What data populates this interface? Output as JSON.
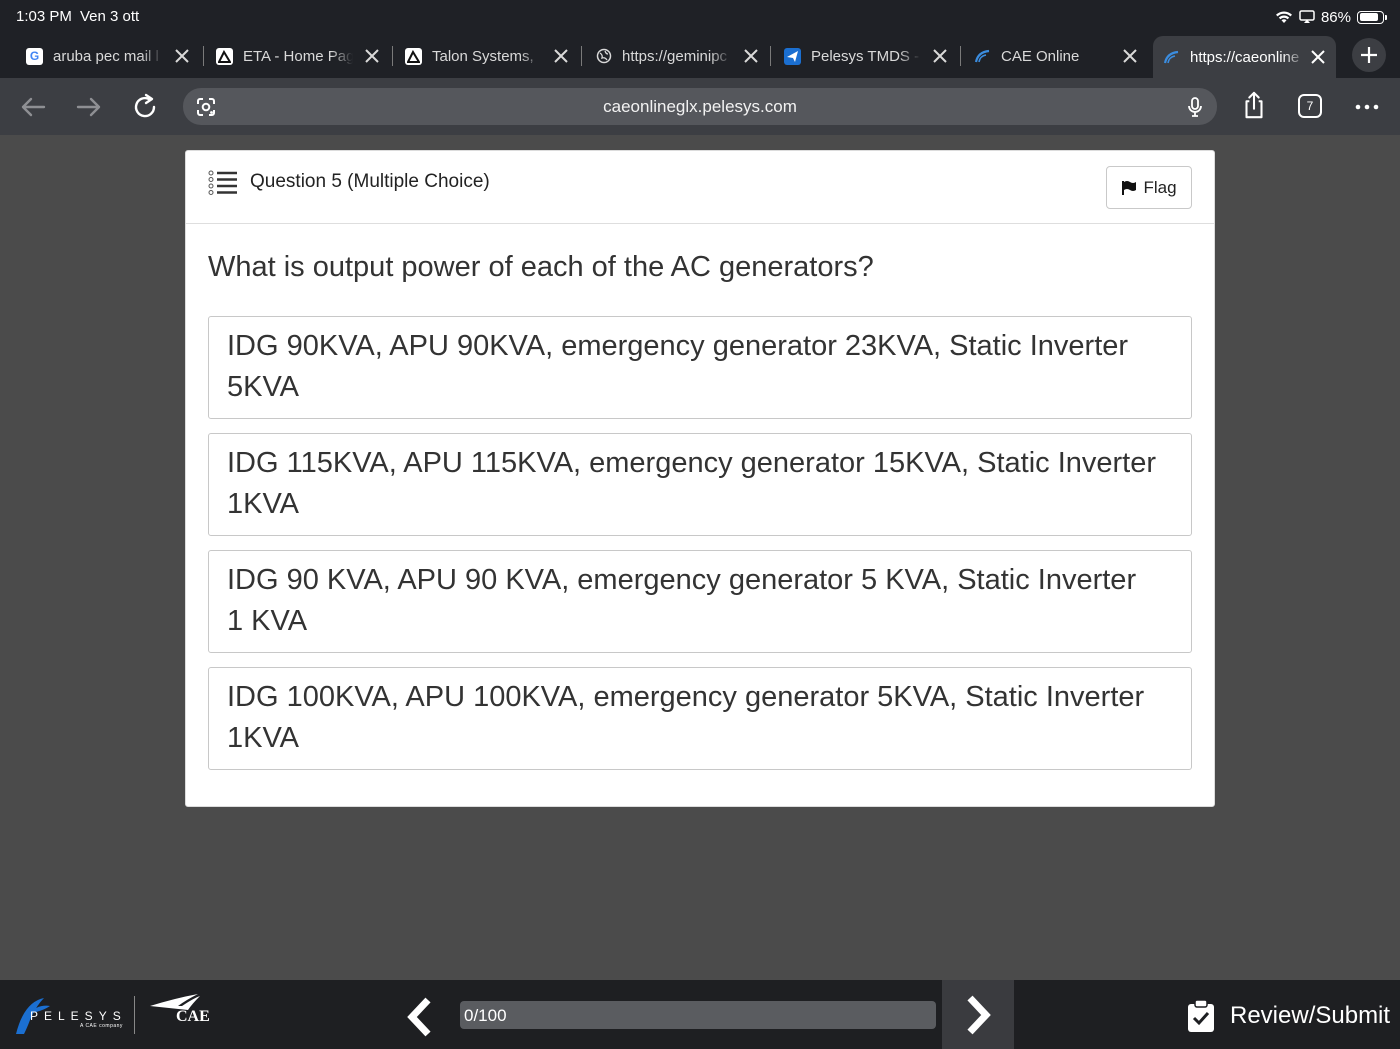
{
  "status": {
    "time": "1:03 PM",
    "date": "Ven 3 ott",
    "battery": "86%",
    "battery_level": 0.86
  },
  "tabs": [
    {
      "label": "aruba pec mail l",
      "icon": "google-icon",
      "active": false
    },
    {
      "label": "ETA - Home Pag",
      "icon": "eta-icon",
      "active": false
    },
    {
      "label": "Talon Systems,",
      "icon": "talon-icon",
      "active": false
    },
    {
      "label": "https://geminipc",
      "icon": "globe-icon",
      "active": false
    },
    {
      "label": "Pelesys TMDS -",
      "icon": "plane-icon",
      "active": false
    },
    {
      "label": "CAE Online",
      "icon": "cae-icon",
      "active": false
    },
    {
      "label": "https://caeonline",
      "icon": "cae-icon",
      "active": true
    }
  ],
  "toolbar": {
    "url": "caeonlineglx.pelesys.com",
    "tab_count": "7"
  },
  "question": {
    "header": "Question 5 (Multiple Choice)",
    "flag_label": "Flag",
    "text": "What is output power of each of the AC generators?",
    "options": [
      "IDG 90KVA, APU 90KVA, emergency generator 23KVA, Static Inverter 5KVA",
      "IDG 115KVA, APU 115KVA, emergency generator 15KVA, Static Inverter 1KVA",
      "IDG 90 KVA, APU 90 KVA, emergency generator 5 KVA, Static Inverter 1 KVA",
      "IDG 100KVA, APU 100KVA, emergency generator 5KVA, Static Inverter 1KVA"
    ]
  },
  "footer": {
    "brand": "PELESYS",
    "brand_sub": "A CAE company",
    "cae": "CAE",
    "progress_text": "0/100",
    "progress_fraction": 0,
    "review_label": "Review/Submit"
  },
  "colors": {
    "chrome_bg": "#1f2126",
    "toolbar_bg": "#3c3e43",
    "page_bg": "#4b4b4b",
    "footer_bg": "#1e1f22",
    "pelesys_blue": "#1b6fd1"
  }
}
